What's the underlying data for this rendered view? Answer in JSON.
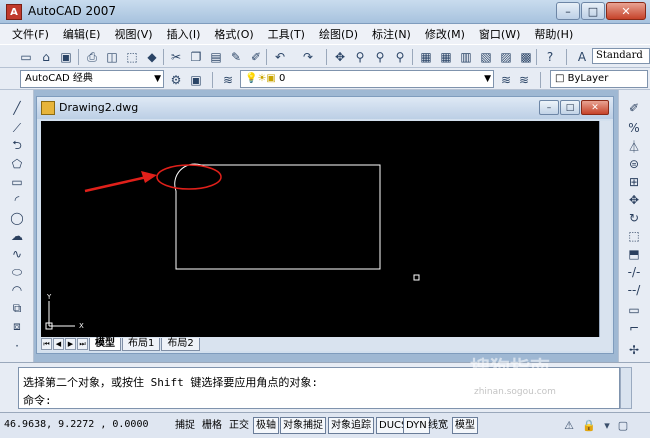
{
  "window": {
    "title": "AutoCAD 2007",
    "min": "–",
    "max": "□",
    "close": "✕"
  },
  "menu": [
    "文件(F)",
    "编辑(E)",
    "视图(V)",
    "插入(I)",
    "格式(O)",
    "工具(T)",
    "绘图(D)",
    "标注(N)",
    "修改(M)",
    "窗口(W)",
    "帮助(H)"
  ],
  "toolbar": {
    "workspace": "AutoCAD 经典",
    "layer": "0",
    "text_style": "Standard",
    "color": "ByLayer"
  },
  "drawing": {
    "title": "Drawing2.dwg",
    "ucs_y": "Y",
    "ucs_x": "X",
    "tabs": [
      "模型",
      "布局1",
      "布局2"
    ]
  },
  "command": {
    "line1": "选择第二个对象，或按住 Shift 键选择要应用角点的对象:",
    "line2": "命令:"
  },
  "status": {
    "coords": "46.9638, 9.2272 , 0.0000",
    "buttons": [
      "捕捉",
      "栅格",
      "正交",
      "极轴",
      "对象捕捉",
      "对象追踪",
      "DUCS",
      "DYN",
      "线宽",
      "模型"
    ]
  },
  "watermark": {
    "text": "搜狗指南",
    "url": "zhinan.sogou.com"
  },
  "colors": {
    "canvas": "#000000",
    "lines": "#ffffff",
    "highlight": "#e0201a"
  }
}
